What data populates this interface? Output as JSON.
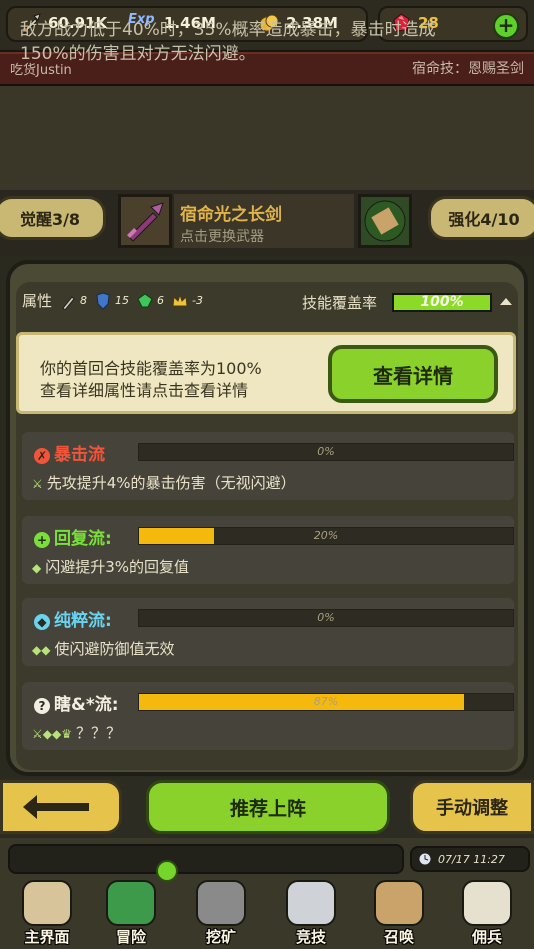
{
  "resources": {
    "attack": "60.91K",
    "exp": "1.46M",
    "gold": "2.38M",
    "gems": "28"
  },
  "title_strip": {
    "left": "吃货Justin",
    "right": "宿命技：恩赐圣剑"
  },
  "description": {
    "line1": "敌方战力低于40%时，35%概率造成暴击，暴击时造成",
    "line2": "150%的伤害且对方无法闪避。"
  },
  "weapon": {
    "awaken_label": "觉醒3/8",
    "name": "宿命光之长剑",
    "subtitle": "点击更换武器",
    "enhance_label": "强化4/10"
  },
  "attributes": {
    "label": "属性",
    "sword": "8",
    "shield": "15",
    "gem": "6",
    "crown": "-3",
    "coverage_label": "技能覆盖率",
    "coverage_value": "100%",
    "coverage_fraction": 1.0
  },
  "banner": {
    "line1": "你的首回合技能覆盖率为100%",
    "line2": "查看详细属性请点击查看详情",
    "button": "查看详情"
  },
  "flows": [
    {
      "title": "暴击流",
      "percent": "0%",
      "fraction": 0.0,
      "desc": "先攻提升4%的暴击伤害（无视闪避）",
      "color": "#f2543a",
      "icon": "✗"
    },
    {
      "title": "回复流:",
      "percent": "20%",
      "fraction": 0.2,
      "desc": "闪避提升3%的回复值",
      "color": "#79e03a",
      "icon": "+"
    },
    {
      "title": "纯粹流:",
      "percent": "0%",
      "fraction": 0.0,
      "desc": "使闪避防御值无效",
      "color": "#69d3f0",
      "icon": "◆"
    },
    {
      "title": "瞎&*流:",
      "percent": "87%",
      "fraction": 0.87,
      "desc": "？？？",
      "color": "#f3efe0",
      "icon": "?"
    }
  ],
  "buttons": {
    "recommend": "推荐上阵",
    "manual": "手动调整"
  },
  "clock": "07/17 11:27",
  "nav": [
    "主界面",
    "冒险",
    "挖矿",
    "竞技",
    "召唤",
    "佣兵"
  ]
}
